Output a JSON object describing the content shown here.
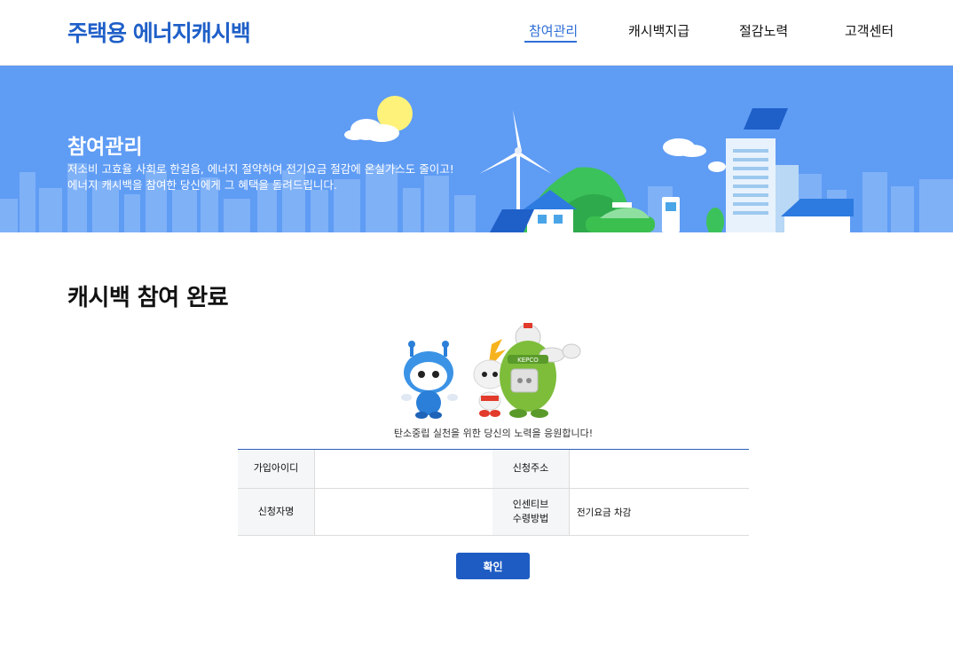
{
  "header": {
    "logo": "주택용 에너지캐시백",
    "nav": [
      {
        "label": "참여관리",
        "active": true
      },
      {
        "label": "캐시백지급",
        "active": false
      },
      {
        "label": "절감노력",
        "active": false
      },
      {
        "label": "고객센터",
        "active": false
      }
    ]
  },
  "banner": {
    "title": "참여관리",
    "desc_line1": "저소비 고효율 사회로 한걸음, 에너지 절약하여 전기요금 절감에 온실가스도 줄이고!",
    "desc_line2": "에너지 캐시백을 참여한 당신에게 그 혜택을 돌려드립니다.",
    "bg_color": "#5f9cf4"
  },
  "main": {
    "title": "캐시백 참여 완료",
    "caption": "탄소중립 실천을 위한 당신의 노력을 응원합니다!",
    "mascot_badge": "KEPCO"
  },
  "info": {
    "user_id_label": "가입아이디",
    "user_id_value": "",
    "address_label": "신청주소",
    "address_value": "",
    "name_label": "신청자명",
    "name_value": "",
    "incentive_label_line1": "인센티브",
    "incentive_label_line2": "수령방법",
    "incentive_value": "전기요금 차감"
  },
  "actions": {
    "confirm_label": "확인"
  },
  "colors": {
    "accent": "#2f6fd6",
    "button": "#1e5cc4",
    "table_border": "#2b5fb9"
  }
}
